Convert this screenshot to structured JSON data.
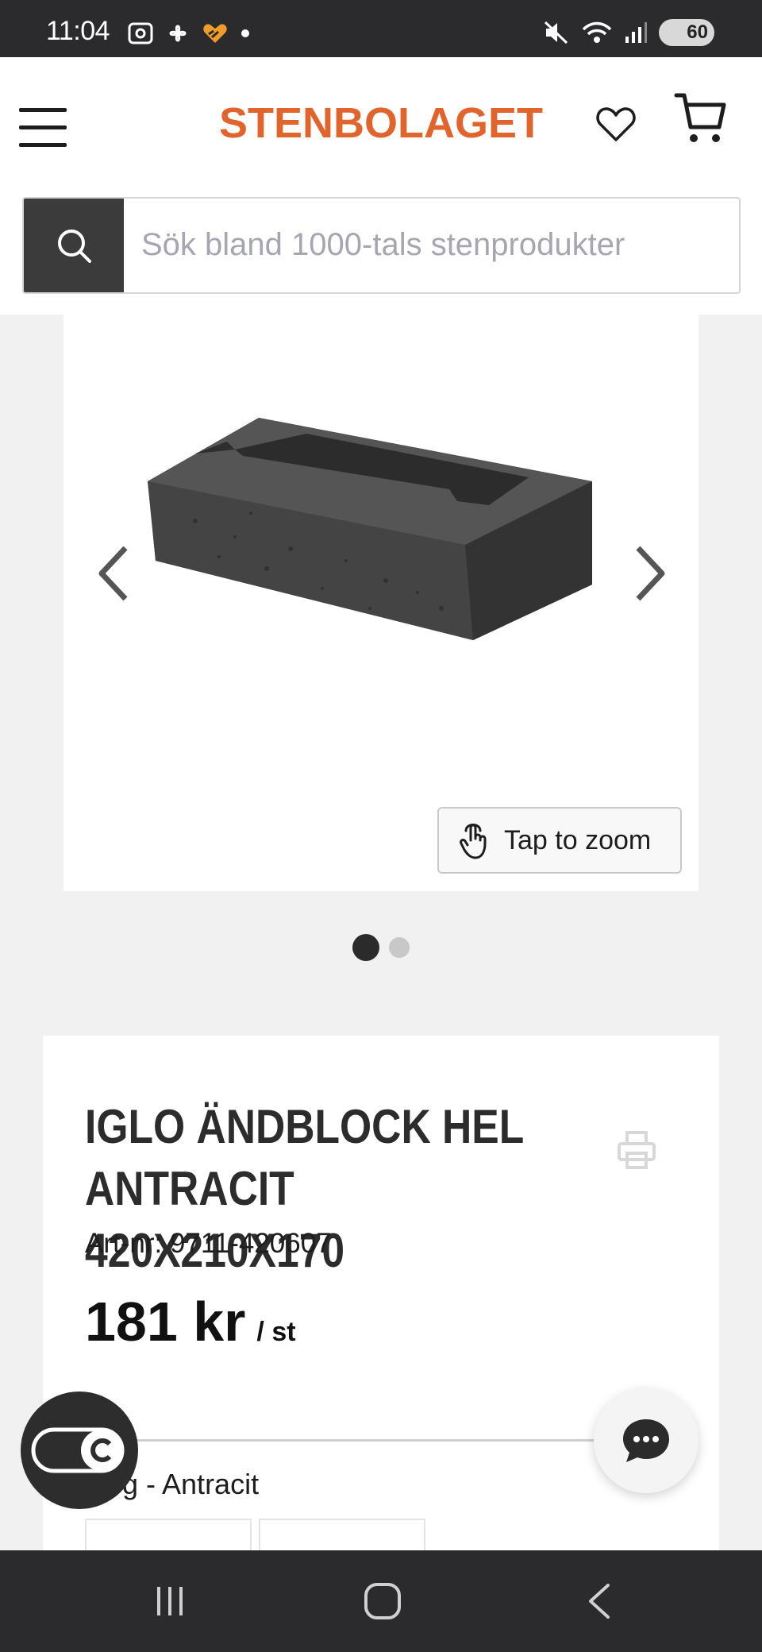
{
  "status_bar": {
    "time": "11:04",
    "battery": "60",
    "icons_left": [
      "screenshot-icon",
      "fan-icon",
      "app-heart-icon",
      "dot-icon"
    ],
    "icons_right": [
      "mute-icon",
      "wifi-icon",
      "signal-icon",
      "battery-icon"
    ]
  },
  "header": {
    "logo": "STENBOLAGET",
    "brand_color": "#e0642c",
    "search_placeholder": "Sök bland 1000-tals stenprodukter"
  },
  "gallery": {
    "zoom_label": "Tap to zoom",
    "image_count": 2,
    "active_index": 0
  },
  "product": {
    "title": "IGLO ÄNDBLOCK HEL ANTRACIT 420X210X170",
    "art_nr": "Art-nr: 9711-420607",
    "price": "181 kr",
    "unit": "/ st",
    "variant_label": "g - Antracit"
  },
  "nav": {
    "buttons": [
      "recent-apps",
      "home",
      "back"
    ]
  }
}
